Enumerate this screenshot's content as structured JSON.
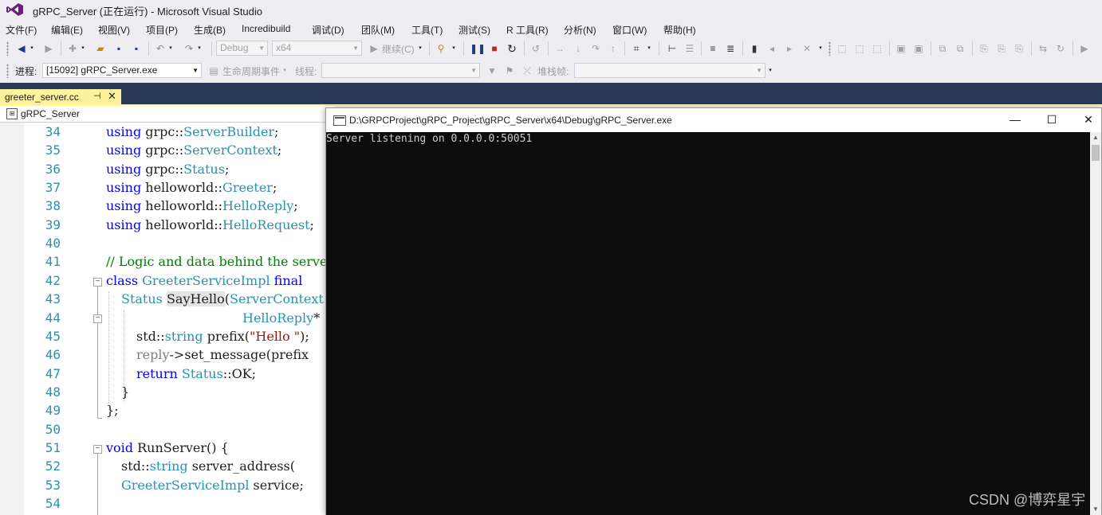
{
  "window": {
    "title": "gRPC_Server (正在运行) - Microsoft Visual Studio"
  },
  "menu": [
    "文件(F)",
    "编辑(E)",
    "视图(V)",
    "项目(P)",
    "生成(B)",
    "Incredibuild",
    "调试(D)",
    "团队(M)",
    "工具(T)",
    "测试(S)",
    "R 工具(R)",
    "分析(N)",
    "窗口(W)",
    "帮助(H)"
  ],
  "toolbar1": {
    "config": "Debug",
    "platform": "x64",
    "continue_label": "继续(C)"
  },
  "toolbar2": {
    "process_label": "进程:",
    "process_value": "[15092] gRPC_Server.exe",
    "lifecycle_label": "生命周期事件",
    "thread_label": "线程:",
    "stackframe_label": "堆栈帧:"
  },
  "editor": {
    "tab_name": "greeter_server.cc",
    "project": "gRPC_Server",
    "line_numbers": [
      "34",
      "35",
      "36",
      "37",
      "38",
      "39",
      "40",
      "41",
      "42",
      "43",
      "44",
      "45",
      "46",
      "47",
      "48",
      "49",
      "50",
      "51",
      "52",
      "53",
      "54"
    ]
  },
  "console": {
    "title": "D:\\GRPCProject\\gRPC_Project\\gRPC_Server\\x64\\Debug\\gRPC_Server.exe",
    "output": "Server listening on 0.0.0.0:50051"
  },
  "watermark": "CSDN @博弈星宇",
  "colors": {
    "tab_active": "#fff29d",
    "navy": "#293955",
    "console_bg": "#0c0c0c",
    "line_number": "#2b91af",
    "keyword": "#0000ff"
  }
}
